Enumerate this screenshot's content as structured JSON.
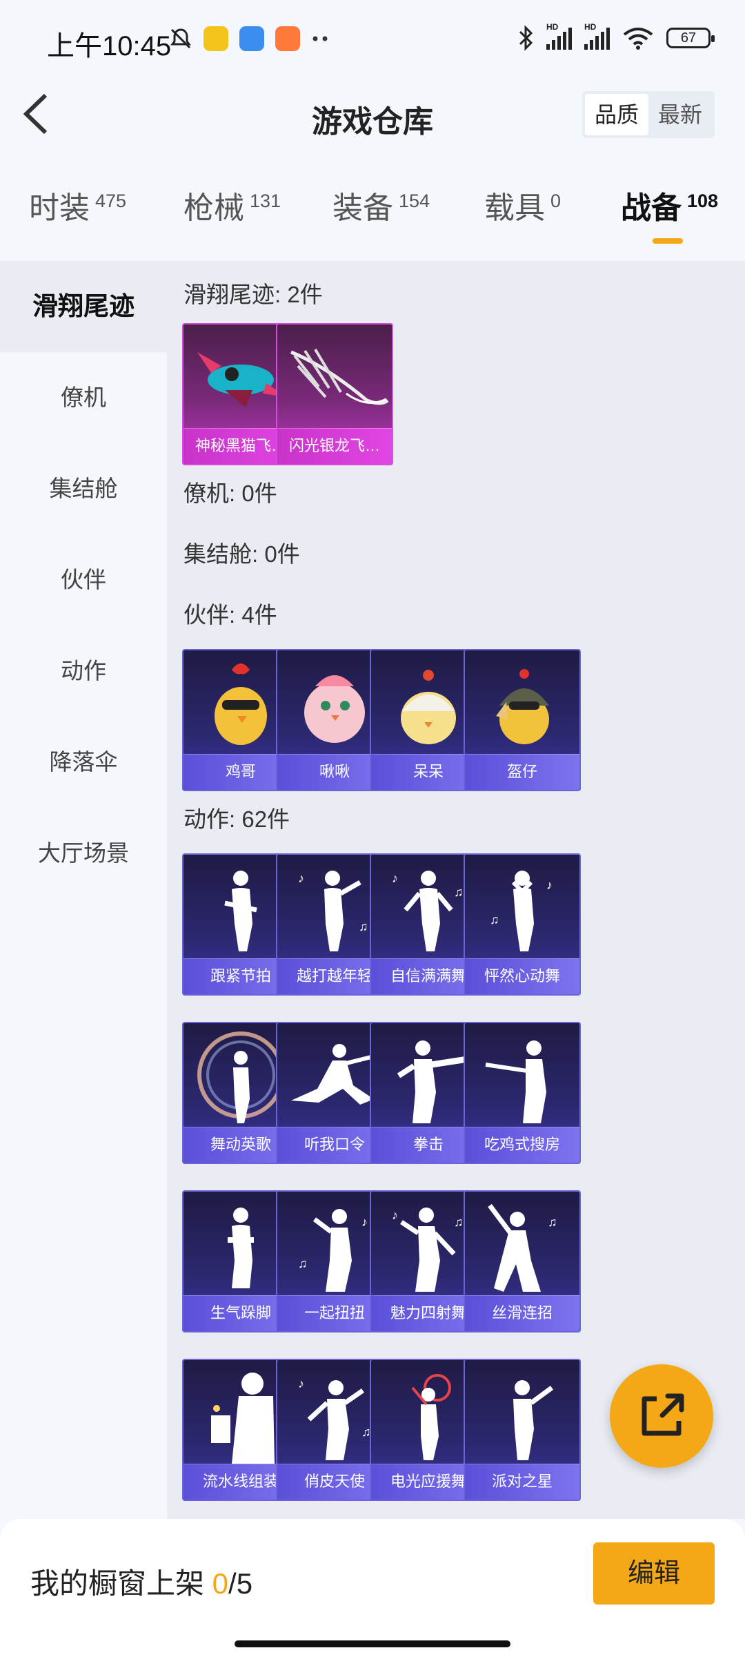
{
  "status_bar": {
    "time": "上午10:45",
    "battery": "67",
    "hd1": "HD",
    "hd2": "HD",
    "icons": [
      "bell-mute-icon",
      "app-icon-yellow",
      "app-icon-blue",
      "app-icon-orange",
      "more-dots-icon",
      "bluetooth-icon",
      "signal-icon",
      "signal-icon",
      "wifi-icon",
      "battery-icon"
    ]
  },
  "header": {
    "title": "游戏仓库",
    "sort_quality": "品质",
    "sort_newest": "最新"
  },
  "tabs": [
    {
      "label": "时装",
      "count": "475"
    },
    {
      "label": "枪械",
      "count": "131"
    },
    {
      "label": "装备",
      "count": "154"
    },
    {
      "label": "载具",
      "count": "0"
    },
    {
      "label": "战备",
      "count": "108"
    }
  ],
  "sidebar": [
    {
      "label": "滑翔尾迹"
    },
    {
      "label": "僚机"
    },
    {
      "label": "集结舱"
    },
    {
      "label": "伙伴"
    },
    {
      "label": "动作"
    },
    {
      "label": "降落伞"
    },
    {
      "label": "大厅场景"
    }
  ],
  "sections": {
    "glide": {
      "title": "滑翔尾迹: 2件",
      "items": [
        {
          "name": "神秘黑猫飞…"
        },
        {
          "name": "闪光银龙飞…"
        }
      ]
    },
    "wingman": {
      "title": "僚机: 0件"
    },
    "pod": {
      "title": "集结舱: 0件"
    },
    "partner": {
      "title": "伙伴: 4件",
      "items": [
        {
          "name": "鸡哥"
        },
        {
          "name": "啾啾"
        },
        {
          "name": "呆呆"
        },
        {
          "name": "盔仔"
        }
      ]
    },
    "emote": {
      "title": "动作: 62件",
      "items": [
        {
          "name": "跟紧节拍"
        },
        {
          "name": "越打越年轻"
        },
        {
          "name": "自信满满舞"
        },
        {
          "name": "怦然心动舞"
        },
        {
          "name": "舞动英歌"
        },
        {
          "name": "听我口令"
        },
        {
          "name": "拳击"
        },
        {
          "name": "吃鸡式搜房"
        },
        {
          "name": "生气跺脚"
        },
        {
          "name": "一起扭扭"
        },
        {
          "name": "魅力四射舞"
        },
        {
          "name": "丝滑连招"
        },
        {
          "name": "流水线组装"
        },
        {
          "name": "俏皮天使"
        },
        {
          "name": "电光应援舞"
        },
        {
          "name": "派对之星"
        }
      ]
    }
  },
  "bottom": {
    "shelf_label": "我的橱窗上架 ",
    "shelf_current": "0",
    "shelf_total": "/5",
    "edit_label": "编辑"
  },
  "colors": {
    "accent": "#f5a815",
    "pink_card": "#c238c2",
    "purple_card": "#3b36a0"
  }
}
